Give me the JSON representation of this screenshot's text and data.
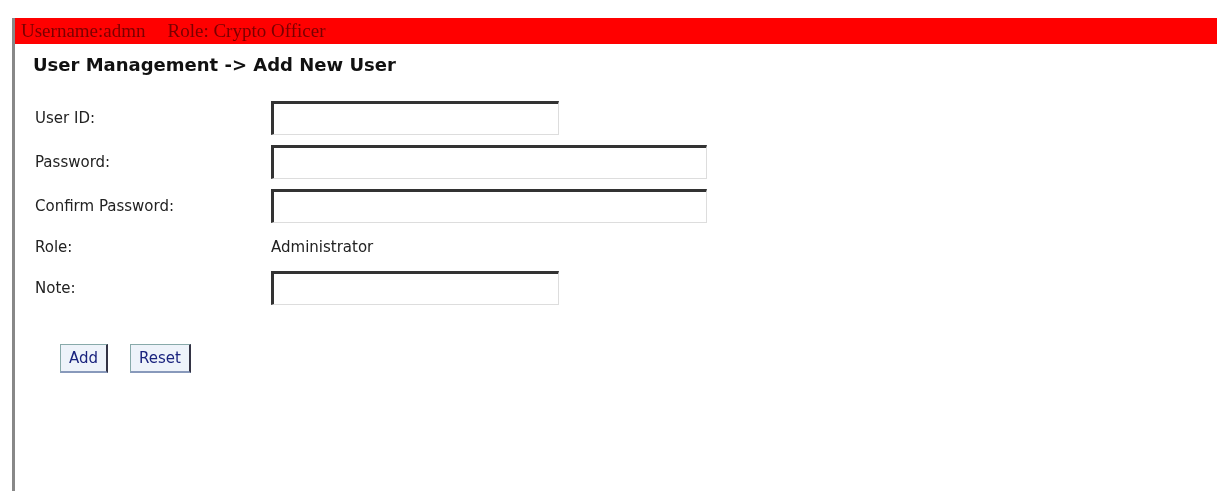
{
  "header": {
    "username": "Username:admn",
    "role": "Role: Crypto Officer"
  },
  "title": "User Management -> Add New User",
  "fields": [
    {
      "label": "User ID:",
      "kind": "input",
      "wide": false
    },
    {
      "label": "Password:",
      "kind": "input",
      "wide": true
    },
    {
      "label": "Confirm Password:",
      "kind": "input",
      "wide": true
    },
    {
      "label": "Role:",
      "kind": "text",
      "value": "Administrator"
    },
    {
      "label": "Note:",
      "kind": "input",
      "wide": false
    }
  ],
  "buttons": [
    "Add",
    "Reset"
  ]
}
